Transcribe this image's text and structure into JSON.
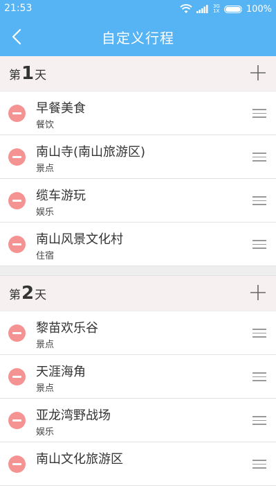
{
  "statusbar": {
    "time": "21:53",
    "network": "3G",
    "network_sub": "1X",
    "battery": "100%"
  },
  "appbar": {
    "title": "自定义行程"
  },
  "days": [
    {
      "prefix": "第",
      "number": "1",
      "suffix": "天",
      "items": [
        {
          "name": "早餐美食",
          "category": "餐饮"
        },
        {
          "name": "南山寺(南山旅游区)",
          "category": "景点"
        },
        {
          "name": "缆车游玩",
          "category": "娱乐"
        },
        {
          "name": "南山风景文化村",
          "category": "住宿"
        }
      ]
    },
    {
      "prefix": "第",
      "number": "2",
      "suffix": "天",
      "items": [
        {
          "name": "黎苗欢乐谷",
          "category": "景点"
        },
        {
          "name": "天涯海角",
          "category": "景点"
        },
        {
          "name": "亚龙湾野战场",
          "category": "娱乐"
        },
        {
          "name": "南山文化旅游区",
          "category": ""
        }
      ]
    }
  ],
  "colors": {
    "accent": "#56b4f5",
    "remove": "#f59393",
    "day_header_bg": "#f7f0f0"
  }
}
